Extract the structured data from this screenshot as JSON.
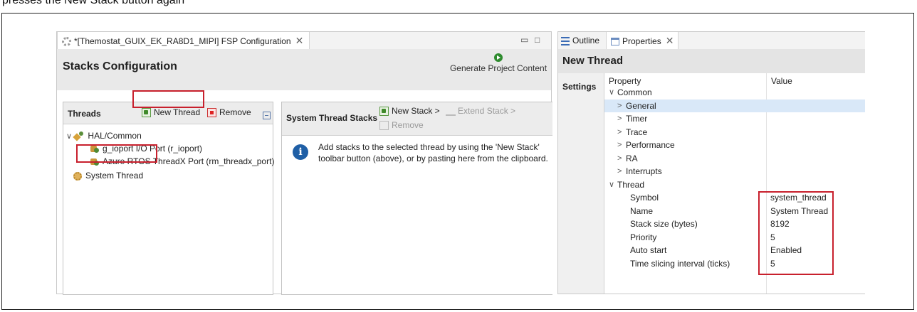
{
  "caption": "presses the New Stack button again",
  "left_tab": {
    "title": "*[Themostat_GUIX_EK_RA8D1_MIPI] FSP Configuration",
    "close": "✕"
  },
  "window_controls": {
    "minimize": "▭",
    "maximize": "□"
  },
  "stacks": {
    "title": "Stacks Configuration",
    "generate_label": "Generate Project Content"
  },
  "threads": {
    "label": "Threads",
    "new_thread": "New Thread",
    "remove": "Remove",
    "tree": {
      "group": "HAL/Common",
      "items": [
        "g_ioport I/O Port (r_ioport)",
        "Azure RTOS ThreadX Port (rm_threadx_port)"
      ],
      "system_thread": "System Thread"
    }
  },
  "stacks_panel": {
    "label": "System Thread Stacks",
    "new_stack": "New Stack >",
    "extend_stack": "Extend Stack >",
    "remove": "Remove",
    "info_icon_glyph": "i",
    "info_text": "Add stacks to the selected thread by using the 'New Stack' toolbar button (above), or by pasting here from the clipboard."
  },
  "right_tabs": {
    "outline": "Outline",
    "properties": "Properties",
    "close": "✕"
  },
  "properties": {
    "title": "New Thread",
    "sidebar_label": "Settings",
    "col_property": "Property",
    "col_value": "Value",
    "rows": [
      {
        "label": "Common",
        "value": "",
        "indent": 0,
        "expander": "∨"
      },
      {
        "label": "General",
        "value": "",
        "indent": 1,
        "expander": ">"
      },
      {
        "label": "Timer",
        "value": "",
        "indent": 1,
        "expander": ">"
      },
      {
        "label": "Trace",
        "value": "",
        "indent": 1,
        "expander": ">"
      },
      {
        "label": "Performance",
        "value": "",
        "indent": 1,
        "expander": ">"
      },
      {
        "label": "RA",
        "value": "",
        "indent": 1,
        "expander": ">"
      },
      {
        "label": "Interrupts",
        "value": "",
        "indent": 1,
        "expander": ">"
      },
      {
        "label": "Thread",
        "value": "",
        "indent": 0,
        "expander": "∨"
      },
      {
        "label": "Symbol",
        "value": "system_thread",
        "indent": 2,
        "expander": ""
      },
      {
        "label": "Name",
        "value": "System Thread",
        "indent": 2,
        "expander": ""
      },
      {
        "label": "Stack size (bytes)",
        "value": "8192",
        "indent": 2,
        "expander": ""
      },
      {
        "label": "Priority",
        "value": "5",
        "indent": 2,
        "expander": ""
      },
      {
        "label": "Auto start",
        "value": "Enabled",
        "indent": 2,
        "expander": ""
      },
      {
        "label": "Time slicing interval (ticks)",
        "value": "5",
        "indent": 2,
        "expander": ""
      }
    ]
  },
  "colors": {
    "highlight": "#c8202d",
    "selection": "#d9e8f8"
  }
}
